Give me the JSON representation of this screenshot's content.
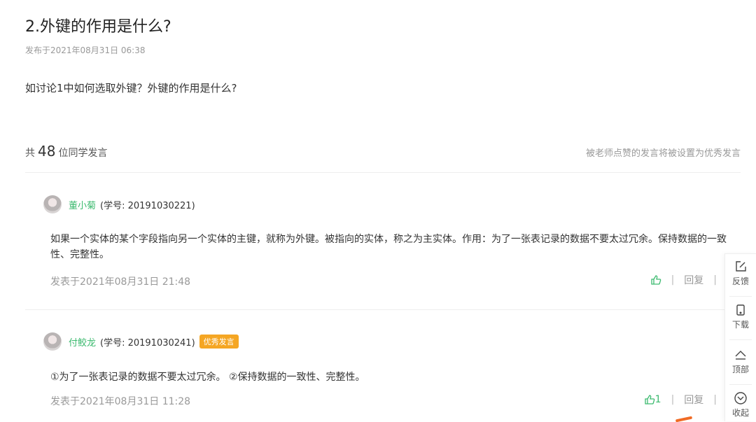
{
  "page": {
    "title": "2.外键的作用是什么?",
    "published": "发布于2021年08月31日 06:38",
    "question": "如讨论1中如何选取外键？外键的作用是什么?"
  },
  "summary": {
    "prefix": "共",
    "count": "48",
    "suffix": "位同学发言",
    "hint": "被老师点赞的发言将被设置为优秀发言"
  },
  "posts": [
    {
      "name": "董小菊",
      "student_id": "(学号: 20191030221)",
      "badge": "",
      "content": "如果一个实体的某个字段指向另一个实体的主键，就称为外键。被指向的实体，称之为主实体。作用：为了一张表记录的数据不要太过冗余。保持数据的一致性、完整性。",
      "date": "发表于2021年08月31日 21:48",
      "likes": "",
      "reply_label": "回复",
      "sep": "|"
    },
    {
      "name": "付鲛龙",
      "student_id": "(学号: 20191030241)",
      "badge": "优秀发言",
      "content": "①为了一张表记录的数据不要太过冗余。 ②保持数据的一致性、完整性。",
      "date": "发表于2021年08月31日 11:28",
      "likes": "1",
      "reply_label": "回复",
      "sep": "|"
    }
  ],
  "sidebar": {
    "feedback": "反馈",
    "download": "下载",
    "top": "顶部",
    "collapse": "收起"
  },
  "colors": {
    "accent_green": "#3cba6f",
    "badge_orange": "#f5a623"
  }
}
